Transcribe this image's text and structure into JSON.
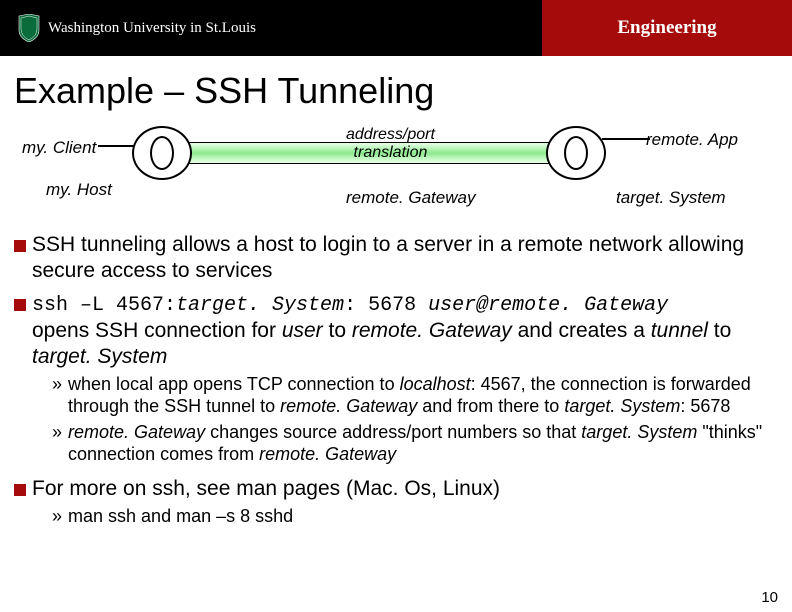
{
  "header": {
    "university": "Washington University in St.Louis",
    "engineering": "Engineering"
  },
  "title": "Example – SSH Tunneling",
  "diagram": {
    "client": "my. Client",
    "host": "my. Host",
    "addr_line1": "address/port",
    "addr_line2": "translation",
    "gateway": "remote. Gateway",
    "app": "remote. App",
    "target": "target. System"
  },
  "bullets": {
    "b1_prefix": "SSH",
    "b1_rest": " tunneling allows a host to login to a server in a remote  network allowing secure access to services",
    "b2_cmd_a": "ssh –L 4567:",
    "b2_cmd_ital1": "target. System",
    "b2_cmd_b": ": 5678 ",
    "b2_cmd_ital2": "user@remote. Gateway",
    "b2_line2_a": "opens SSH connection for ",
    "b2_line2_user": "user",
    "b2_line2_b": " to ",
    "b2_line2_gw": "remote. Gateway",
    "b2_line2_c": " and creates a ",
    "b2_line2_tun": "tunnel",
    "b2_line2_d": " to ",
    "b2_line2_ts": "target. System",
    "sub1_a": "when local app opens TCP connection to ",
    "sub1_lh": "localhost",
    "sub1_b": ": 4567, the connection is forwarded through the SSH tunnel to ",
    "sub1_gw": "remote. Gateway",
    "sub1_c": " and from there to ",
    "sub1_ts": "target. System",
    "sub1_d": ": 5678",
    "sub2_gw": "remote. Gateway",
    "sub2_a": " changes source address/port numbers so that ",
    "sub2_ts": "target. System",
    "sub2_b": " \"thinks\" connection comes from ",
    "sub2_gw2": "remote. Gateway",
    "b3_prefix": "For",
    "b3_rest": " more on ssh, see man pages (Mac. Os, Linux)",
    "sub3": "man ssh and man –s 8 sshd"
  },
  "page_number": "10",
  "chev": "»"
}
